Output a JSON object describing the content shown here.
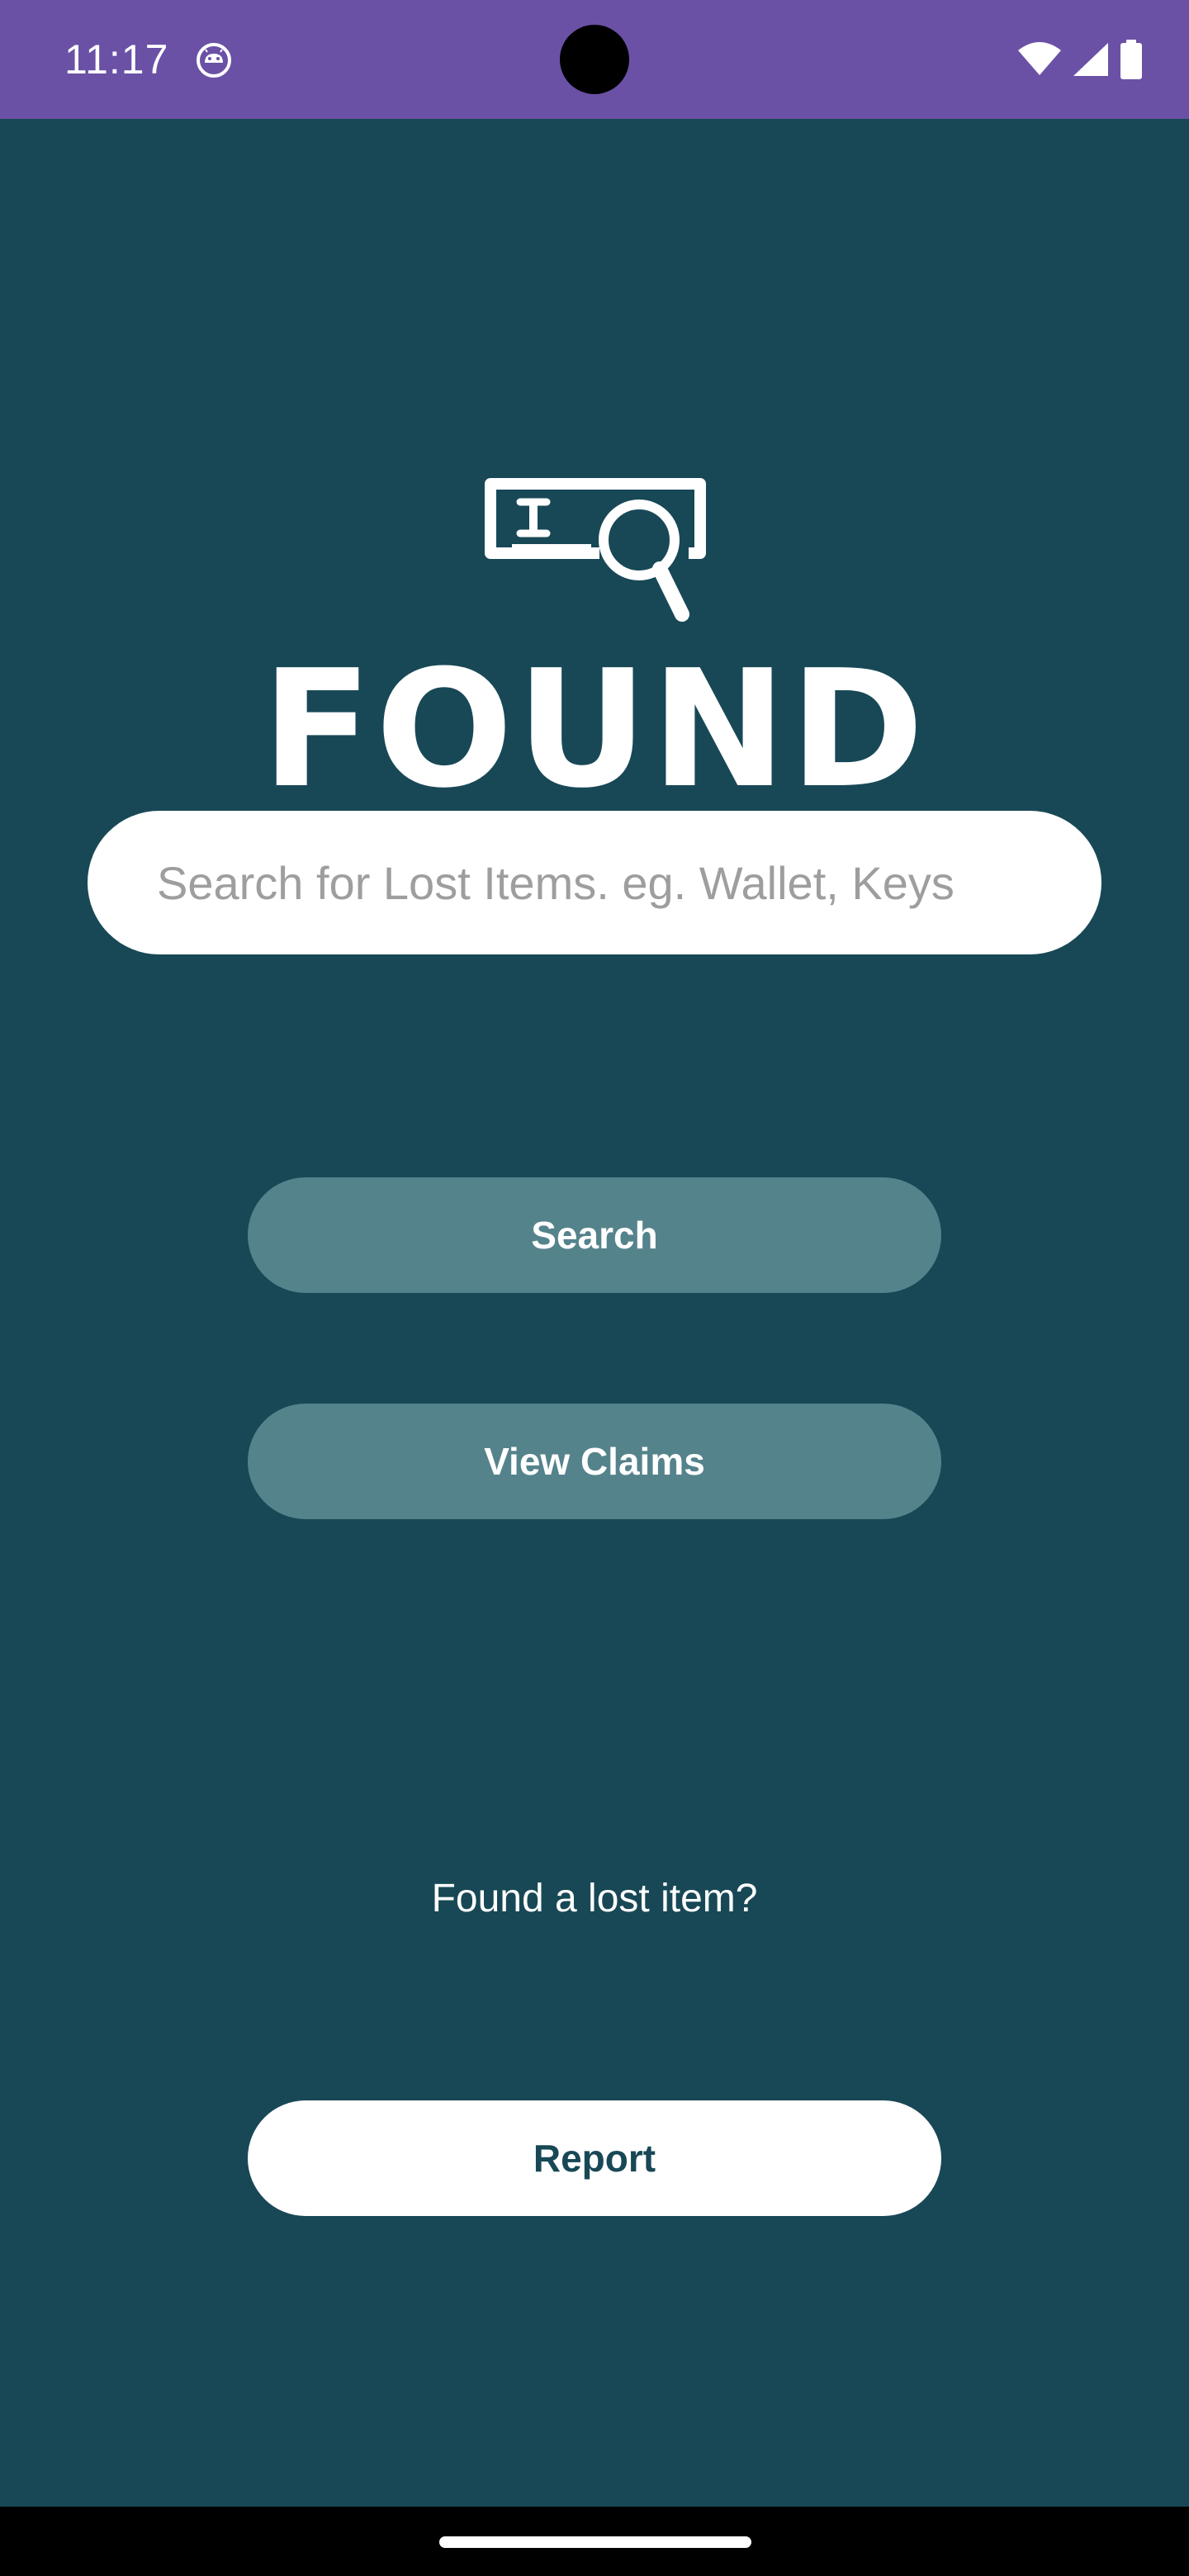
{
  "status_bar": {
    "time": "11:17",
    "app_icon": "android-app-icon",
    "wifi_icon": "wifi-icon",
    "signal_icon": "cell-signal-icon",
    "battery_icon": "battery-icon"
  },
  "app": {
    "logo_icon": "id-card-search-icon",
    "logo_text": "FOUND",
    "background_color": "#184856",
    "status_bar_color": "#6a51a6"
  },
  "search": {
    "placeholder": "Search for Lost Items. eg. Wallet, Keys",
    "value": ""
  },
  "buttons": {
    "search_label": "Search",
    "view_claims_label": "View Claims",
    "report_label": "Report"
  },
  "report_section": {
    "prompt": "Found a lost item?"
  }
}
